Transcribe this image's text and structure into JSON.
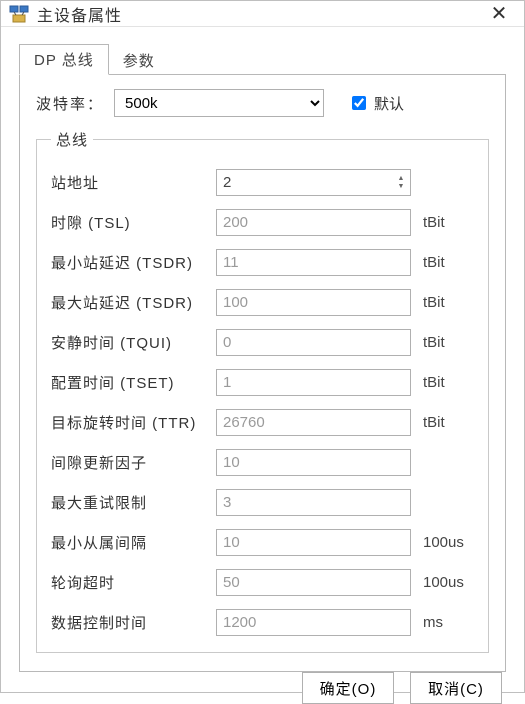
{
  "window": {
    "title": "主设备属性"
  },
  "tabs": {
    "bus": "DP 总线",
    "params": "参数"
  },
  "baud": {
    "label": "波特率：",
    "value": "500k",
    "default_label": "默认",
    "default_checked": true
  },
  "group": {
    "legend": "总线"
  },
  "fields": {
    "addr": {
      "label": "站地址",
      "value": "2",
      "unit": "",
      "readonly": false,
      "spinner": true
    },
    "tsl": {
      "label": "时隙 (TSL)",
      "value": "200",
      "unit": "tBit",
      "readonly": true,
      "spinner": false
    },
    "mintsdr": {
      "label": "最小站延迟 (TSDR)",
      "value": "11",
      "unit": "tBit",
      "readonly": true,
      "spinner": false
    },
    "maxtsdr": {
      "label": "最大站延迟 (TSDR)",
      "value": "100",
      "unit": "tBit",
      "readonly": true,
      "spinner": false
    },
    "tqui": {
      "label": "安静时间 (TQUI)",
      "value": "0",
      "unit": "tBit",
      "readonly": true,
      "spinner": false
    },
    "tset": {
      "label": "配置时间 (TSET)",
      "value": "1",
      "unit": "tBit",
      "readonly": true,
      "spinner": false
    },
    "ttr": {
      "label": "目标旋转时间 (TTR)",
      "value": "26760",
      "unit": "tBit",
      "readonly": true,
      "spinner": false
    },
    "gap": {
      "label": "间隙更新因子",
      "value": "10",
      "unit": "",
      "readonly": true,
      "spinner": false
    },
    "retry": {
      "label": "最大重试限制",
      "value": "3",
      "unit": "",
      "readonly": true,
      "spinner": false
    },
    "slave": {
      "label": "最小从属间隔",
      "value": "10",
      "unit": "100us",
      "readonly": true,
      "spinner": false
    },
    "poll": {
      "label": "轮询超时",
      "value": "50",
      "unit": "100us",
      "readonly": true,
      "spinner": false
    },
    "dctrl": {
      "label": "数据控制时间",
      "value": "1200",
      "unit": "ms",
      "readonly": true,
      "spinner": false
    }
  },
  "field_order": [
    "addr",
    "tsl",
    "mintsdr",
    "maxtsdr",
    "tqui",
    "tset",
    "ttr",
    "gap",
    "retry",
    "slave",
    "poll",
    "dctrl"
  ],
  "buttons": {
    "ok": "确定(O)",
    "cancel": "取消(C)"
  }
}
